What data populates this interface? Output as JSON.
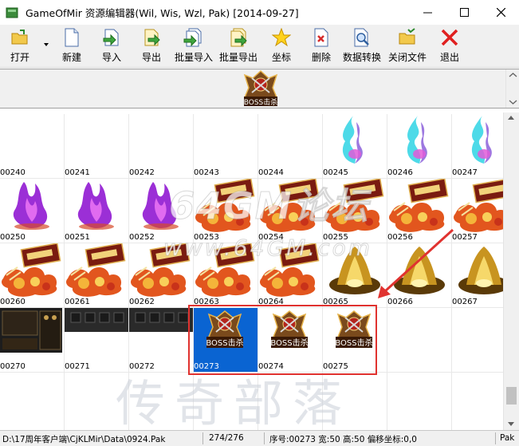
{
  "window": {
    "title": "GameOfMir 资源编辑器(Wil, Wis, Wzl, Pak) [2014-09-27]"
  },
  "toolbar": {
    "buttons": [
      {
        "id": "open",
        "label": "打开",
        "icon": "open-folder-icon"
      },
      {
        "id": "new",
        "label": "新建",
        "icon": "new-file-icon"
      },
      {
        "id": "import",
        "label": "导入",
        "icon": "import-icon"
      },
      {
        "id": "export",
        "label": "导出",
        "icon": "export-icon"
      },
      {
        "id": "batch-import",
        "label": "批量导入",
        "icon": "batch-import-icon"
      },
      {
        "id": "batch-export",
        "label": "批量导出",
        "icon": "batch-export-icon"
      },
      {
        "id": "coordinates",
        "label": "坐标",
        "icon": "star-icon"
      },
      {
        "id": "delete",
        "label": "删除",
        "icon": "delete-icon"
      },
      {
        "id": "convert",
        "label": "数据转换",
        "icon": "convert-icon"
      },
      {
        "id": "close-file",
        "label": "关闭文件",
        "icon": "close-file-icon"
      },
      {
        "id": "exit",
        "label": "退出",
        "icon": "exit-icon"
      }
    ]
  },
  "preview": {
    "badge_text": "BOSS击杀"
  },
  "grid": {
    "rows": [
      [
        {
          "label": "00240",
          "kind": "empty"
        },
        {
          "label": "00241",
          "kind": "empty"
        },
        {
          "label": "00242",
          "kind": "empty"
        },
        {
          "label": "00243",
          "kind": "empty"
        },
        {
          "label": "00244",
          "kind": "empty"
        },
        {
          "label": "00245",
          "kind": "cyan-flame"
        },
        {
          "label": "00246",
          "kind": "cyan-flame"
        },
        {
          "label": "00247",
          "kind": "cyan-flame"
        }
      ],
      [
        {
          "label": "00250",
          "kind": "purple-flame"
        },
        {
          "label": "00251",
          "kind": "purple-flame"
        },
        {
          "label": "00252",
          "kind": "purple-flame"
        },
        {
          "label": "00253",
          "kind": "explosion-banner"
        },
        {
          "label": "00254",
          "kind": "explosion-banner"
        },
        {
          "label": "00255",
          "kind": "explosion-banner"
        },
        {
          "label": "00256",
          "kind": "explosion-banner"
        },
        {
          "label": "00257",
          "kind": "explosion-banner"
        }
      ],
      [
        {
          "label": "00260",
          "kind": "explosion-banner"
        },
        {
          "label": "00261",
          "kind": "explosion-banner"
        },
        {
          "label": "00262",
          "kind": "explosion-banner"
        },
        {
          "label": "00263",
          "kind": "explosion-banner"
        },
        {
          "label": "00264",
          "kind": "explosion-banner"
        },
        {
          "label": "00265",
          "kind": "gold-glow"
        },
        {
          "label": "00266",
          "kind": "gold-glow"
        },
        {
          "label": "00267",
          "kind": "gold-glow"
        }
      ],
      [
        {
          "label": "00270",
          "kind": "dark-panel"
        },
        {
          "label": "00271",
          "kind": "dark-bar"
        },
        {
          "label": "00272",
          "kind": "dark-bar"
        },
        {
          "label": "00273",
          "kind": "boss-badge",
          "selected": true
        },
        {
          "label": "00274",
          "kind": "boss-badge"
        },
        {
          "label": "00275",
          "kind": "boss-badge"
        },
        {
          "label": "",
          "kind": "empty"
        },
        {
          "label": "",
          "kind": "empty"
        }
      ],
      [
        {
          "label": "",
          "kind": "empty"
        },
        {
          "label": "",
          "kind": "empty"
        },
        {
          "label": "",
          "kind": "empty"
        },
        {
          "label": "",
          "kind": "empty"
        },
        {
          "label": "",
          "kind": "empty"
        },
        {
          "label": "",
          "kind": "empty"
        },
        {
          "label": "",
          "kind": "empty"
        },
        {
          "label": "",
          "kind": "empty"
        }
      ]
    ],
    "badge_text": "BOSS击杀"
  },
  "watermarks": {
    "forum": "64GM论坛",
    "site": "www.64GM.com",
    "brand": "传奇部落"
  },
  "statusbar": {
    "path": "D:\\17周年客户端\\CjKLMir\\Data\\0924.Pak",
    "count": "274/276",
    "info": "序号:00273 宽:50 高:50 偏移坐标:0,0",
    "format": "Pak"
  },
  "colors": {
    "selection": "#0a64d2",
    "annotation": "#e0322f"
  }
}
